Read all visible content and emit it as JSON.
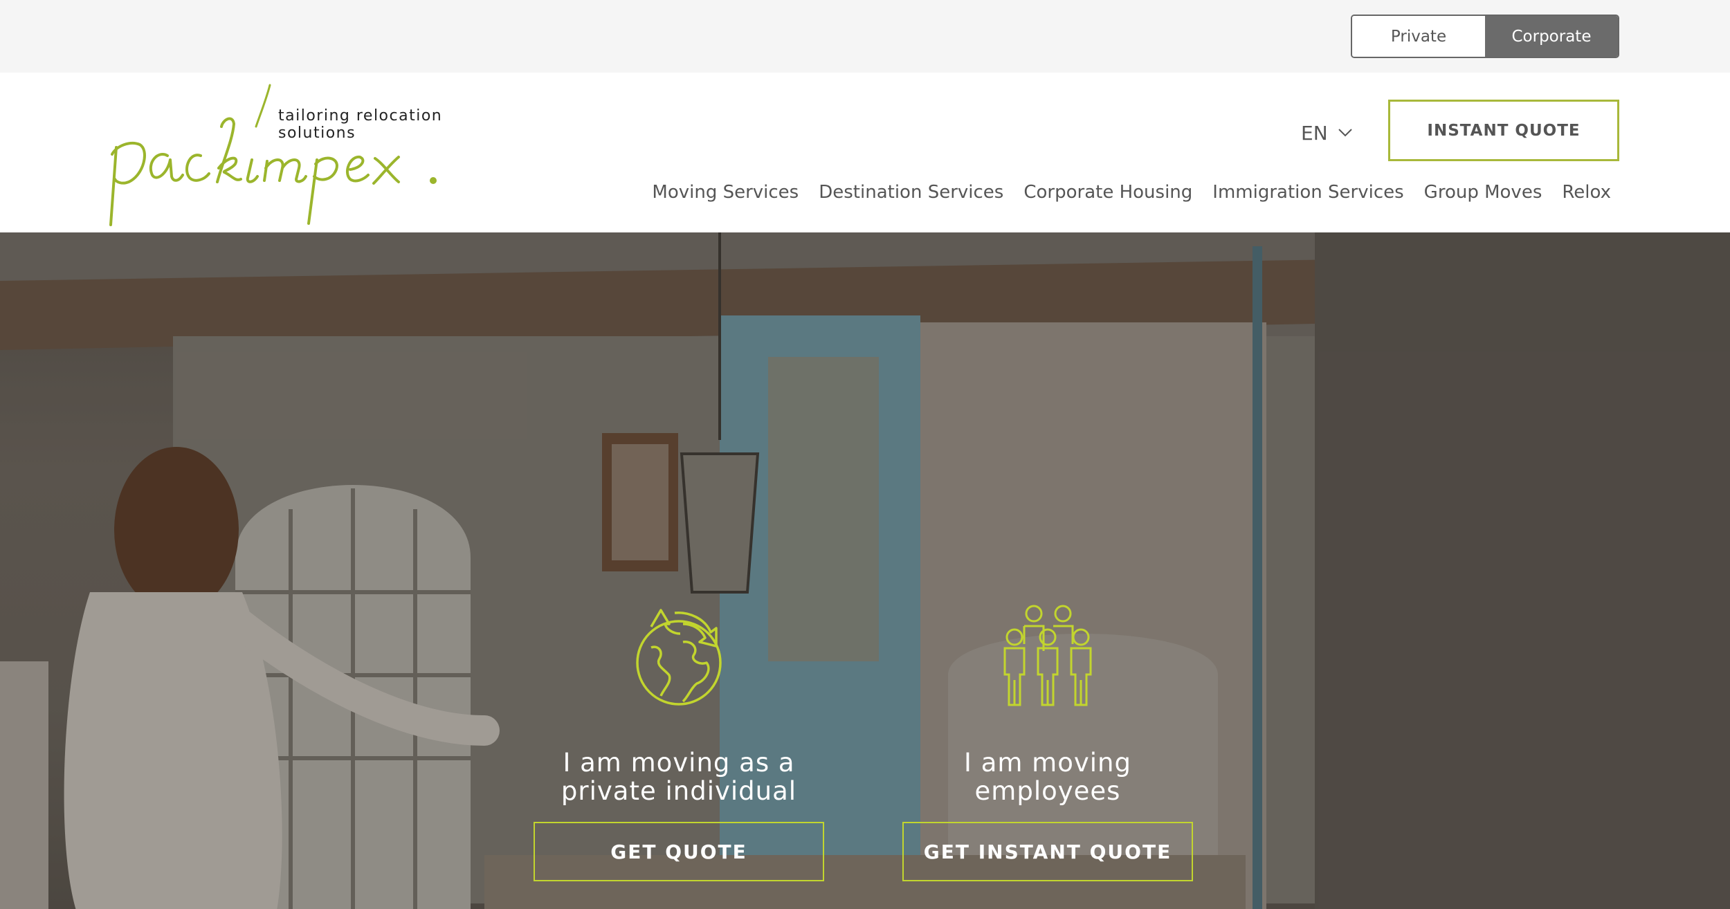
{
  "topbar": {
    "audience": [
      {
        "label": "Private",
        "active": false
      },
      {
        "label": "Corporate",
        "active": true
      }
    ]
  },
  "header": {
    "logo_wordmark": "packimpex.",
    "tagline": "tailoring relocation solutions",
    "language": "EN",
    "instant_quote_label": "INSTANT QUOTE",
    "nav": [
      {
        "label": "Moving Services"
      },
      {
        "label": "Destination Services"
      },
      {
        "label": "Corporate Housing"
      },
      {
        "label": "Immigration Services"
      },
      {
        "label": "Group Moves"
      },
      {
        "label": "Relox"
      }
    ]
  },
  "hero": {
    "choices": [
      {
        "icon": "globe-arrows-icon",
        "text": "I am moving as a\nprivate individual",
        "button": "GET QUOTE"
      },
      {
        "icon": "group-people-icon",
        "text": "I am moving\nemployees",
        "button": "GET INSTANT QUOTE"
      }
    ]
  },
  "colors": {
    "accent_green": "#a8b83a",
    "toggle_active": "#6b6b6b",
    "topbar_bg": "#f5f5f5"
  }
}
